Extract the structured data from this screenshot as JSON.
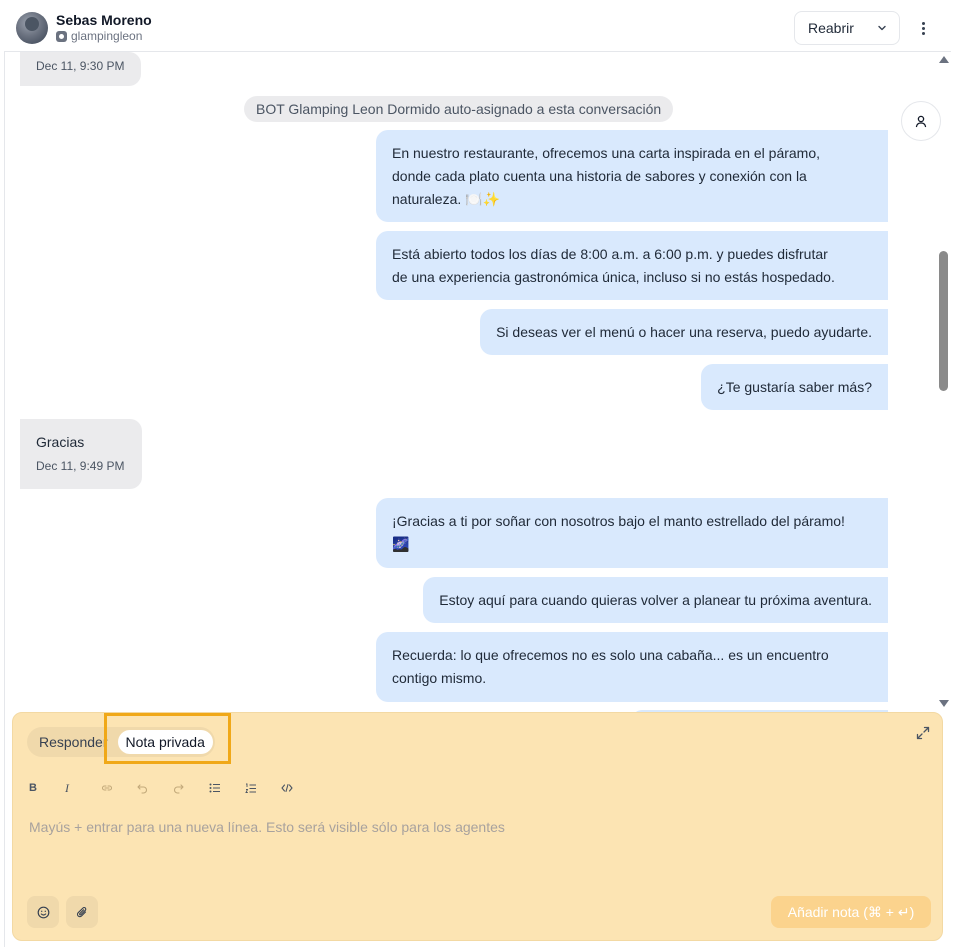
{
  "header": {
    "contact_name": "Sebas Moreno",
    "inbox_name": "glampingleon",
    "reopen_label": "Reabrir"
  },
  "messages": {
    "top_timestamp": "Dec 11, 9:30 PM",
    "activity_text": "BOT Glamping Leon Dormido auto-asignado a esta conversación",
    "outgoing_1": [
      "En nuestro restaurante, ofrecemos una carta inspirada en el páramo,",
      "donde cada plato cuenta una historia de sabores y conexión con la",
      "naturaleza. 🍽️✨"
    ],
    "outgoing_2": [
      "Está abierto todos los días de 8:00 a.m. a 6:00 p.m. y puedes disfrutar",
      "de una experiencia gastronómica única, incluso si no estás hospedado."
    ],
    "outgoing_3": "Si deseas ver el menú o hacer una reserva, puedo ayudarte.",
    "outgoing_4": "¿Te gustaría saber más?",
    "incoming_1": {
      "text": "Gracias",
      "timestamp": "Dec 11, 9:49 PM"
    },
    "outgoing_5": [
      "¡Gracias a ti por soñar con nosotros bajo el manto estrellado del páramo!",
      "🌌"
    ],
    "outgoing_6": "Estoy aquí para cuando quieras volver a planear tu próxima aventura.",
    "outgoing_7": [
      "Recuerda: lo que ofrecemos no es solo una cabaña... es un encuentro",
      "contigo mismo."
    ]
  },
  "composer": {
    "reply_tab": "Responder",
    "note_tab": "Nota privada",
    "placeholder": "Mayús + entrar para una nueva línea. Esto será visible sólo para los agentes",
    "submit_label": "Añadir nota (⌘ + ↵)",
    "toolbar": [
      "bold-icon",
      "italic-icon",
      "link-icon",
      "undo-icon",
      "redo-icon",
      "bullet-list-icon",
      "ordered-list-icon",
      "code-icon"
    ]
  },
  "colors": {
    "outgoing_bubble": "#d9e9fd",
    "incoming_bubble": "#ebebed",
    "composer_bg": "#fce4b3",
    "highlight": "#f0a818"
  }
}
